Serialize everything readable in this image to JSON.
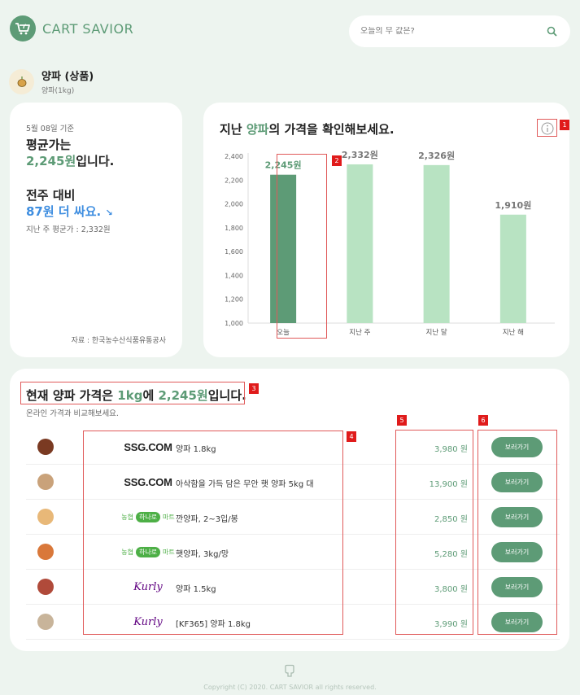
{
  "header": {
    "logo_text": "CART SAVIOR",
    "search_placeholder": "오늘의 무 값은?"
  },
  "product": {
    "name": "양파 (상품)",
    "unit": "양파(1kg)"
  },
  "summary": {
    "date_label": "5월 08일 기준",
    "avg_prefix": "평균가는",
    "avg_price": "2,245원",
    "avg_suffix": "입니다.",
    "compare_label": "전주 대비",
    "compare_value": "87원 더 싸요.",
    "compare_arrow": "↘",
    "last_week": "지난 주 평균가 : 2,332원",
    "source": "자료 : 한국농수산식품유통공사"
  },
  "chart_card": {
    "title_prefix": "지난 ",
    "title_highlight": "양파",
    "title_suffix": "의 가격을 확인해보세요."
  },
  "chart_data": {
    "type": "bar",
    "categories": [
      "오늘",
      "지난 주",
      "지난 달",
      "지난 해"
    ],
    "values": [
      2245,
      2332,
      2326,
      1910
    ],
    "data_labels": [
      "2,245원",
      "2,332원",
      "2,326원",
      "1,910원"
    ],
    "ylim": [
      1000,
      2400
    ],
    "yticks": [
      1000,
      1200,
      1400,
      1600,
      1800,
      2000,
      2200,
      2400
    ],
    "ytick_labels": [
      "1,000",
      "1,200",
      "1,400",
      "1,600",
      "1,800",
      "2,000",
      "2,200",
      "2,400"
    ],
    "colors": [
      "#5d9b76",
      "#b8e3c2",
      "#b8e3c2",
      "#b8e3c2"
    ],
    "label_colors": [
      "#5d9b76",
      "#777777",
      "#777777",
      "#777777"
    ],
    "grid": false
  },
  "listing": {
    "title_a": "현재 양파 가격은 ",
    "title_unit": "1kg",
    "title_b": "에 ",
    "title_price": "2,245원",
    "title_c": "입니다.",
    "subtitle": "온라인 가격과 비교해보세요.",
    "button_label": "보러가기",
    "rows": [
      {
        "store": "SSG.COM",
        "store_type": "ssg",
        "name": "양파 1.8kg",
        "price": "3,980 원",
        "thumb": "#7a3a22"
      },
      {
        "store": "SSG.COM",
        "store_type": "ssg",
        "name": "아삭함을 가득 담은 무안 햇 양파 5kg 대",
        "price": "13,900 원",
        "thumb": "#c9a27a"
      },
      {
        "store": "농협하나로마트",
        "store_type": "nh",
        "name": "깐양파, 2~3입/봉",
        "price": "2,850 원",
        "thumb": "#e8b878"
      },
      {
        "store": "농협하나로마트",
        "store_type": "nh",
        "name": "햇양파, 3kg/망",
        "price": "5,280 원",
        "thumb": "#d9783a"
      },
      {
        "store": "Kurly",
        "store_type": "kurly",
        "name": "양파 1.5kg",
        "price": "3,800 원",
        "thumb": "#b04a3a"
      },
      {
        "store": "Kurly",
        "store_type": "kurly",
        "name": "[KF365] 양파 1.8kg",
        "price": "3,990 원",
        "thumb": "#c8b49a"
      }
    ]
  },
  "annotations": [
    "1",
    "2",
    "3",
    "4",
    "5",
    "6"
  ],
  "footer": {
    "copyright": "Copyright (C) 2020. CART SAVIOR all rights reserved."
  }
}
